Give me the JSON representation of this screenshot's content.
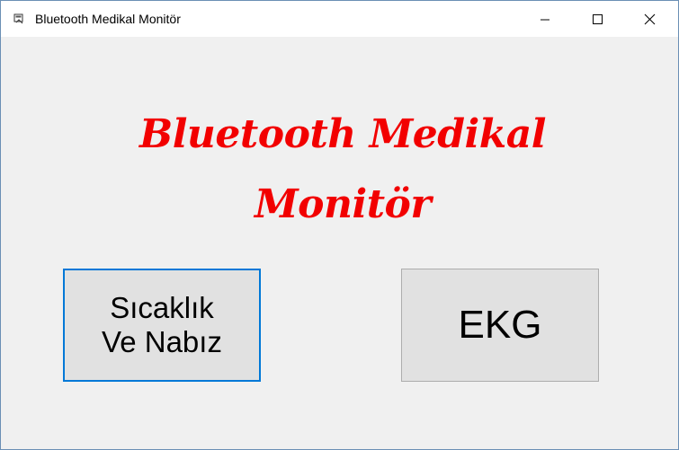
{
  "window": {
    "title": "Bluetooth Medikal Monitör",
    "icon": "app-icon",
    "controls": {
      "minimize": "minimize-icon",
      "maximize": "maximize-icon",
      "close": "close-icon"
    }
  },
  "heading": {
    "line1": "Bluetooth Medikal",
    "line2": "Monitör",
    "color": "#f20000"
  },
  "buttons": {
    "sicaklik": {
      "line1": "Sıcaklık",
      "line2": "Ve Nabız"
    },
    "ekg": {
      "label": "EKG"
    }
  },
  "colors": {
    "focus_border": "#0078d7",
    "button_face": "#e1e1e1",
    "window_bg": "#f0f0f0"
  }
}
